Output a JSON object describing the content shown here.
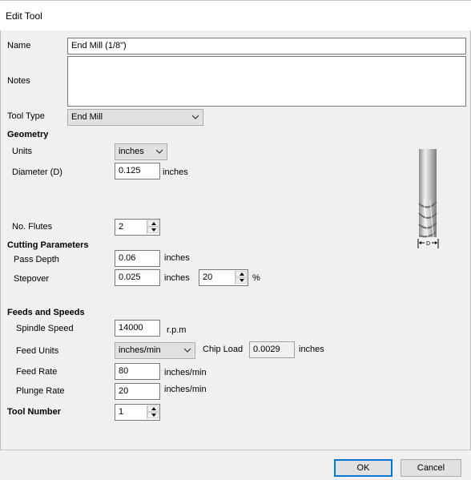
{
  "window": {
    "title": "Edit Tool"
  },
  "fields": {
    "name_label": "Name",
    "name_value": "End Mill (1/8\")",
    "notes_label": "Notes",
    "notes_value": "",
    "tool_type_label": "Tool Type",
    "tool_type_value": "End Mill"
  },
  "geometry": {
    "header": "Geometry",
    "units_label": "Units",
    "units_value": "inches",
    "diameter_label": "Diameter (D)",
    "diameter_value": "0.125",
    "diameter_unit": "inches",
    "flutes_label": "No. Flutes",
    "flutes_value": "2",
    "diagram_label": "D"
  },
  "cutting": {
    "header": "Cutting Parameters",
    "pass_depth_label": "Pass Depth",
    "pass_depth_value": "0.06",
    "pass_depth_unit": "inches",
    "stepover_label": "Stepover",
    "stepover_value": "0.025",
    "stepover_unit": "inches",
    "stepover_percent_value": "20",
    "stepover_percent_unit": "%"
  },
  "feeds": {
    "header": "Feeds and Speeds",
    "spindle_label": "Spindle Speed",
    "spindle_value": "14000",
    "spindle_unit": "r.p.m",
    "feed_units_label": "Feed Units",
    "feed_units_value": "inches/min",
    "chip_load_label": "Chip Load",
    "chip_load_value": "0.0029",
    "chip_load_unit": "inches",
    "feed_rate_label": "Feed Rate",
    "feed_rate_value": "80",
    "feed_rate_unit": "inches/min",
    "plunge_rate_label": "Plunge Rate",
    "plunge_rate_value": "20",
    "plunge_rate_unit": "inches/min"
  },
  "tool_number": {
    "header": "Tool Number",
    "value": "1"
  },
  "buttons": {
    "ok": "OK",
    "cancel": "Cancel"
  },
  "colors": {
    "focus_border": "#0078d7",
    "dialog_bg": "#f0f0f0"
  }
}
